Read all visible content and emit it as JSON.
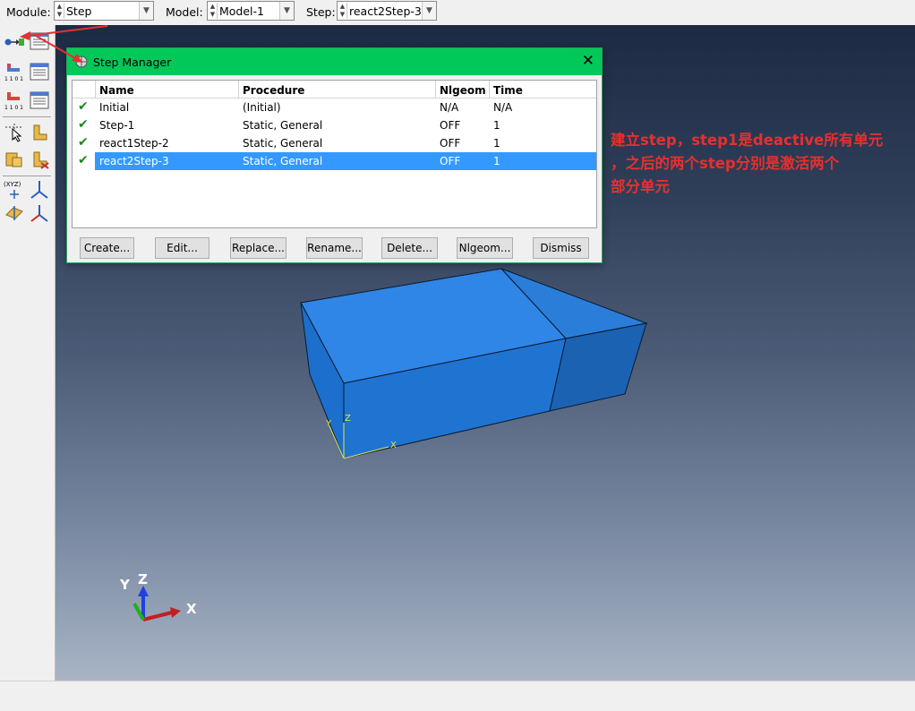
{
  "context_bar": {
    "module_label": "Module:",
    "module_value": "Step",
    "model_label": "Model:",
    "model_value": "Model-1",
    "step_label": "Step:",
    "step_value": "react2Step-3"
  },
  "dialog": {
    "title": "Step Manager",
    "columns": [
      "Name",
      "Procedure",
      "Nlgeom",
      "Time"
    ],
    "rows": [
      {
        "name": "Initial",
        "procedure": "(Initial)",
        "nlgeom": "N/A",
        "time": "N/A",
        "checked": true,
        "selected": false
      },
      {
        "name": "Step-1",
        "procedure": "Static, General",
        "nlgeom": "OFF",
        "time": "1",
        "checked": true,
        "selected": false
      },
      {
        "name": "react1Step-2",
        "procedure": "Static, General",
        "nlgeom": "OFF",
        "time": "1",
        "checked": true,
        "selected": false
      },
      {
        "name": "react2Step-3",
        "procedure": "Static, General",
        "nlgeom": "OFF",
        "time": "1",
        "checked": true,
        "selected": true
      }
    ],
    "buttons": [
      "Create...",
      "Edit...",
      "Replace...",
      "Rename...",
      "Delete...",
      "Nlgeom...",
      "Dismiss"
    ]
  },
  "annotation": {
    "line1": "建立step，step1是deactive所有单元",
    "line2": "，之后的两个step分别是激活两个",
    "line3": "部分单元"
  },
  "model_triad": {
    "x": "X",
    "y": "Y",
    "z": "Z"
  },
  "view_triad": {
    "x": "X",
    "y": "Y",
    "z": "Z"
  },
  "toolbox": {
    "row1": "(XYZ)",
    "row2": "1 1 0 1 0"
  },
  "colors": {
    "dialog_title": "#00c95a",
    "selection": "#3399ff",
    "part_face": "#1f78d6",
    "annotation": "#e53030",
    "check": "#1a8a1a"
  }
}
